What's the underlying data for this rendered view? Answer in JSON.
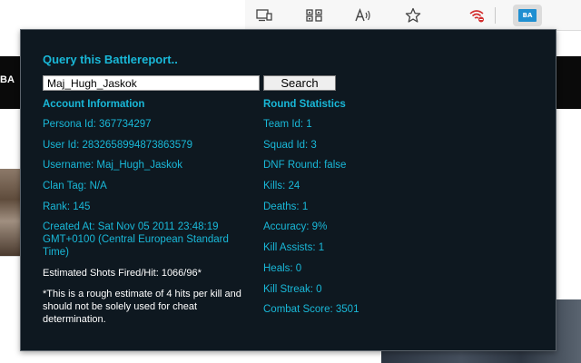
{
  "toolbar": {
    "icons": [
      "cast-icon",
      "qr-code-icon",
      "read-aloud-icon",
      "favorite-star-icon",
      "wifi-extension-icon",
      "battlereport-extension-icon"
    ],
    "extension_badge": "BA"
  },
  "background": {
    "nav_fragment": "BA"
  },
  "popup": {
    "title": "Query this Battlereport..",
    "search_value": "Maj_Hugh_Jaskok",
    "search_button": "Search",
    "account": {
      "heading": "Account Information",
      "persona_id": "Persona Id: 367734297",
      "user_id": "User Id: 2832658994873863579",
      "username": "Username: Maj_Hugh_Jaskok",
      "clan_tag": "Clan Tag: N/A",
      "rank": "Rank: 145",
      "created_at": "Created At: Sat Nov 05 2011 23:48:19 GMT+0100 (Central European Standard Time)",
      "shots": "Estimated Shots Fired/Hit: 1066/96*",
      "disclaimer": "*This is a rough estimate of 4 hits per kill and should not be solely used for cheat determination."
    },
    "round": {
      "heading": "Round Statistics",
      "team_id": "Team Id: 1",
      "squad_id": "Squad Id: 3",
      "dnf_round": "DNF Round: false",
      "kills": "Kills: 24",
      "deaths": "Deaths: 1",
      "accuracy": "Accuracy: 9%",
      "kill_assists": "Kill Assists: 1",
      "heals": "Heals: 0",
      "kill_streak": "Kill Streak: 0",
      "combat_score": "Combat Score: 3501"
    }
  },
  "colors": {
    "popup_bg": "#0e1820",
    "accent_cyan": "#19b8d8",
    "badge_blue": "#1f8fd1",
    "wifi_red": "#d32f2f"
  }
}
